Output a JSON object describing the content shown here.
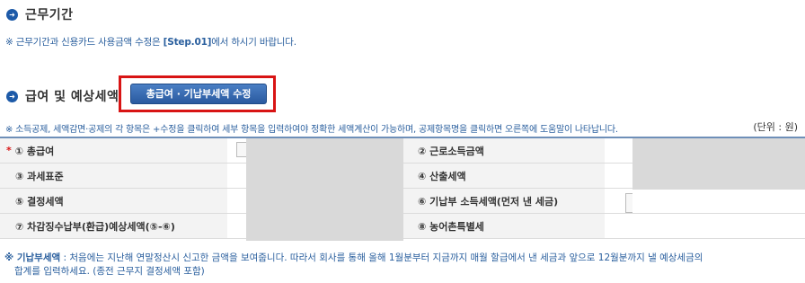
{
  "section1": {
    "bullet": "➜",
    "title": "근무기간",
    "note_prefix": "※ 근무기간과 신용카드 사용금액 수정은 ",
    "note_link": "[Step.01]",
    "note_suffix": "에서 하시기 바랍니다."
  },
  "section2": {
    "bullet": "➜",
    "title": "급여 및 예상세액",
    "edit_button": "총급여 · 기납부세액 수정",
    "note": "※ 소득공제, 세액감면·공제의 각 항목은 +수정을 클릭하여 세부 항목을 입력하여야 정확한 세액계산이 가능하며, 공제항목명을 클릭하면 오른쪽에 도움말이 나타납니다.",
    "unit": "(단위 : 원)"
  },
  "table": {
    "required_mark": "*",
    "rows": [
      {
        "left_label": "① 총급여",
        "right_label": "② 근로소득금액"
      },
      {
        "left_label": "③ 과세표준",
        "right_label": "④ 산출세액"
      },
      {
        "left_label": "⑤ 결정세액",
        "right_label": "⑥ 기납부 소득세액(먼저 낸 세금)"
      },
      {
        "left_label": "⑦ 차감징수납부(환급)예상세액(⑤-⑥)",
        "right_label": "⑧ 농어촌특별세"
      }
    ]
  },
  "footnote": {
    "term": "※ 기납부세액",
    "line1": " : 처음에는 지난해 연말정산시 신고한 금액을 보여줍니다. 따라서 회사를 통해 올해 1월분부터 지금까지 매월 할급에서 낸 세금과 앞으로 12월분까지 낼 예상세금의",
    "line2": "합계를 입력하세요. (종전 근무지 결정세액 포함)"
  },
  "colors": {
    "accent": "#1d5aa8",
    "highlight_border": "#d81414",
    "note_text": "#2a5f9e",
    "masked_value": "#d9d9d9"
  },
  "icons": {
    "section_bullet": "arrow-circle-icon"
  }
}
